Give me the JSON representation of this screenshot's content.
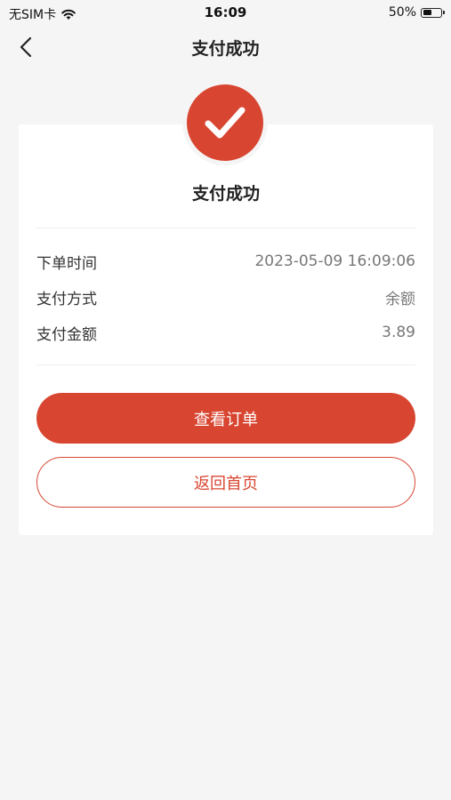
{
  "status_bar": {
    "carrier": "无SIM卡",
    "time": "16:09",
    "battery": "50%",
    "battery_level": 0.5
  },
  "nav": {
    "title": "支付成功",
    "back_icon": "chevron-left-icon"
  },
  "result": {
    "icon": "checkmark-icon",
    "title": "支付成功"
  },
  "details": [
    {
      "label": "下单时间",
      "value": "2023-05-09 16:09:06"
    },
    {
      "label": "支付方式",
      "value": "余额"
    },
    {
      "label": "支付金额",
      "value": "3.89"
    }
  ],
  "buttons": {
    "view_order": "查看订单",
    "back_home": "返回首页"
  },
  "colors": {
    "accent": "#d84632",
    "background": "#f5f5f5"
  }
}
